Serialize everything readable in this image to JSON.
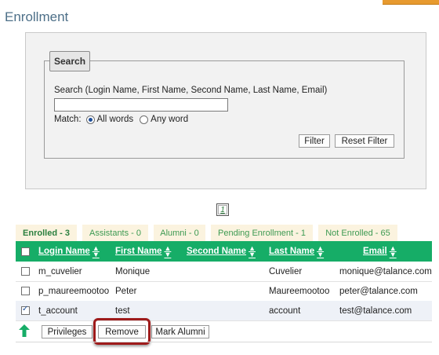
{
  "page": {
    "title": "Enrollment"
  },
  "search": {
    "legend": "Search",
    "label": "Search (Login Name, First Name, Second Name, Last Name, Email)",
    "value": "",
    "placeholder": "",
    "match_label": "Match:",
    "option_all": "All words",
    "option_any": "Any word",
    "selected_option": "All words",
    "filter_label": "Filter",
    "reset_label": "Reset Filter"
  },
  "pager": {
    "current_page": "1"
  },
  "tabs": [
    {
      "label": "Enrolled - 3",
      "active": true
    },
    {
      "label": "Assistants - 0",
      "active": false
    },
    {
      "label": "Alumni - 0",
      "active": false
    },
    {
      "label": "Pending Enrollment - 1",
      "active": false
    },
    {
      "label": "Not Enrolled - 65",
      "active": false
    }
  ],
  "table": {
    "columns": [
      "Login Name",
      "First Name",
      "Second Name",
      "Last Name",
      "Email"
    ],
    "rows": [
      {
        "login": "m_cuvelier",
        "first": "Monique",
        "second": "",
        "last": "Cuvelier",
        "email": "monique@talance.com",
        "checked": false
      },
      {
        "login": "p_maureemootoo",
        "first": "Peter",
        "second": "",
        "last": "Maureemootoo",
        "email": "peter@talance.com",
        "checked": false
      },
      {
        "login": "t_account",
        "first": "test",
        "second": "",
        "last": "account",
        "email": "test@talance.com",
        "checked": true
      }
    ]
  },
  "actions": {
    "privileges_label": "Privileges",
    "remove_label": "Remove",
    "mark_alumni_label": "Mark Alumni"
  },
  "colors": {
    "header_green": "#16ad67",
    "tab_background": "#fbf3df",
    "title_blue": "#4d6f88",
    "highlight_red": "#9e1b1b"
  }
}
